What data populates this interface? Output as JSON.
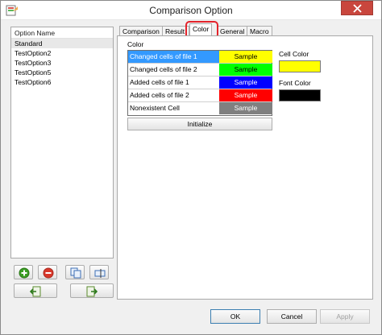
{
  "window": {
    "title": "Comparison Option"
  },
  "options": {
    "header": "Option Name",
    "items": [
      "Standard",
      "TestOption2",
      "TestOption3",
      "TestOption5",
      "TestOption6"
    ],
    "selected_index": 0
  },
  "tabs": [
    "Comparison",
    "Result",
    "Color",
    "General",
    "Macro"
  ],
  "active_tab": "Color",
  "color_group": {
    "label": "Color",
    "rows": [
      {
        "name": "Changed cells of file 1",
        "sample": "Sample",
        "color": "#ffff00",
        "text_color": "#000000"
      },
      {
        "name": "Changed cells of file 2",
        "sample": "Sample",
        "color": "#00ff00",
        "text_color": "#000000"
      },
      {
        "name": "Added cells of file 1",
        "sample": "Sample",
        "color": "#0000ff",
        "text_color": "#ffffff"
      },
      {
        "name": "Added cells of file 2",
        "sample": "Sample",
        "color": "#ff0000",
        "text_color": "#ffffff"
      },
      {
        "name": "Nonexistent Cell",
        "sample": "Sample",
        "color": "#808080",
        "text_color": "#ffffff"
      }
    ],
    "selected_row": 0,
    "initialize_label": "Initialize"
  },
  "cell_color": {
    "label": "Cell Color",
    "value": "#ffff00"
  },
  "font_color": {
    "label": "Font Color",
    "value": "#000000"
  },
  "buttons": {
    "ok": "OK",
    "cancel": "Cancel",
    "apply": "Apply"
  },
  "icons": [
    "add-icon",
    "remove-icon",
    "copy-icon",
    "rename-icon",
    "import-icon",
    "export-icon",
    "close-icon",
    "app-icon"
  ]
}
